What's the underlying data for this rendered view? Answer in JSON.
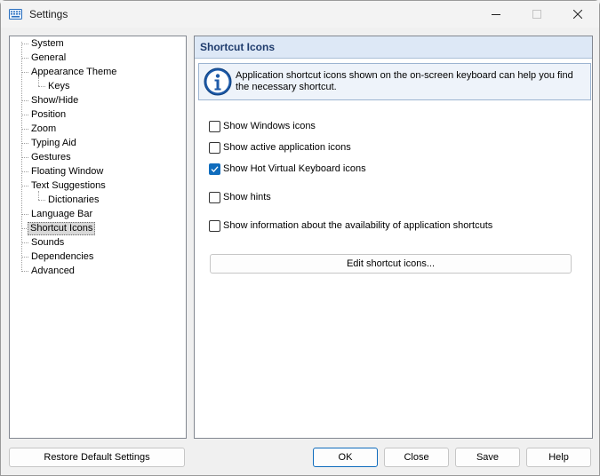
{
  "window": {
    "title": "Settings"
  },
  "tree": {
    "items": [
      {
        "label": "System"
      },
      {
        "label": "General"
      },
      {
        "label": "Appearance Theme"
      },
      {
        "label": "Keys"
      },
      {
        "label": "Show/Hide"
      },
      {
        "label": "Position"
      },
      {
        "label": "Zoom"
      },
      {
        "label": "Typing Aid"
      },
      {
        "label": "Gestures"
      },
      {
        "label": "Floating Window"
      },
      {
        "label": "Text Suggestions"
      },
      {
        "label": "Dictionaries"
      },
      {
        "label": "Language Bar"
      },
      {
        "label": "Shortcut Icons"
      },
      {
        "label": "Sounds"
      },
      {
        "label": "Dependencies"
      },
      {
        "label": "Advanced"
      }
    ],
    "selected": "Shortcut Icons"
  },
  "content": {
    "title": "Shortcut Icons",
    "info_text": "Application shortcut icons shown on the on-screen keyboard can help you find the necessary shortcut.",
    "options": [
      {
        "label": "Show Windows icons",
        "checked": false
      },
      {
        "label": "Show active application icons",
        "checked": false
      },
      {
        "label": "Show Hot Virtual Keyboard icons",
        "checked": true
      },
      {
        "label": "Show hints",
        "checked": false
      },
      {
        "label": "Show information about the availability of application shortcuts",
        "checked": false
      }
    ],
    "edit_button": "Edit shortcut icons..."
  },
  "footer": {
    "restore": "Restore Default Settings",
    "ok": "OK",
    "close": "Close",
    "save": "Save",
    "help": "Help"
  },
  "colors": {
    "accent": "#0f6cbd",
    "header_bg": "#dde8f6",
    "header_text": "#1f3c6d"
  }
}
